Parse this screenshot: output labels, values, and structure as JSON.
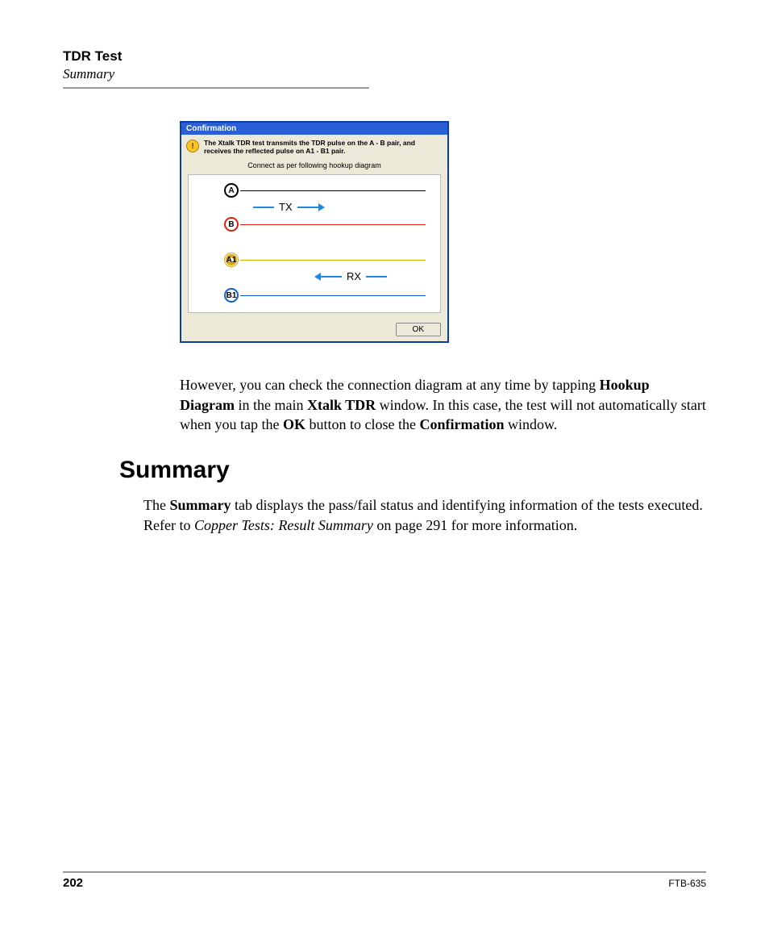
{
  "header": {
    "title": "TDR Test",
    "subtitle": "Summary"
  },
  "dialog": {
    "title": "Confirmation",
    "warn_glyph": "!",
    "message": "The Xtalk TDR test transmits the TDR pulse on the A - B pair, and receives the reflected pulse on A1 - B1 pair.",
    "sub_message": "Connect as per following hookup diagram",
    "nodes": {
      "a": "A",
      "b": "B",
      "a1": "A1",
      "b1": "B1"
    },
    "tx_label": "TX",
    "rx_label": "RX",
    "ok_label": "OK"
  },
  "para1": {
    "t1": "However, you can check the connection diagram at any time by tapping ",
    "b1": "Hookup Diagram",
    "t2": " in the main ",
    "b2": "Xtalk TDR",
    "t3": " window. In this case, the test will not automatically start when you tap the ",
    "b3": "OK",
    "t4": " button to close the ",
    "b4": "Confirmation",
    "t5": " window."
  },
  "section_heading": "Summary",
  "para2": {
    "t1": "The ",
    "b1": "Summary",
    "t2": " tab displays the pass/fail status and identifying information of the tests executed. Refer to ",
    "i1": "Copper Tests: Result Summary",
    "t3": " on page 291 for more information."
  },
  "footer": {
    "page": "202",
    "docid": "FTB-635"
  }
}
